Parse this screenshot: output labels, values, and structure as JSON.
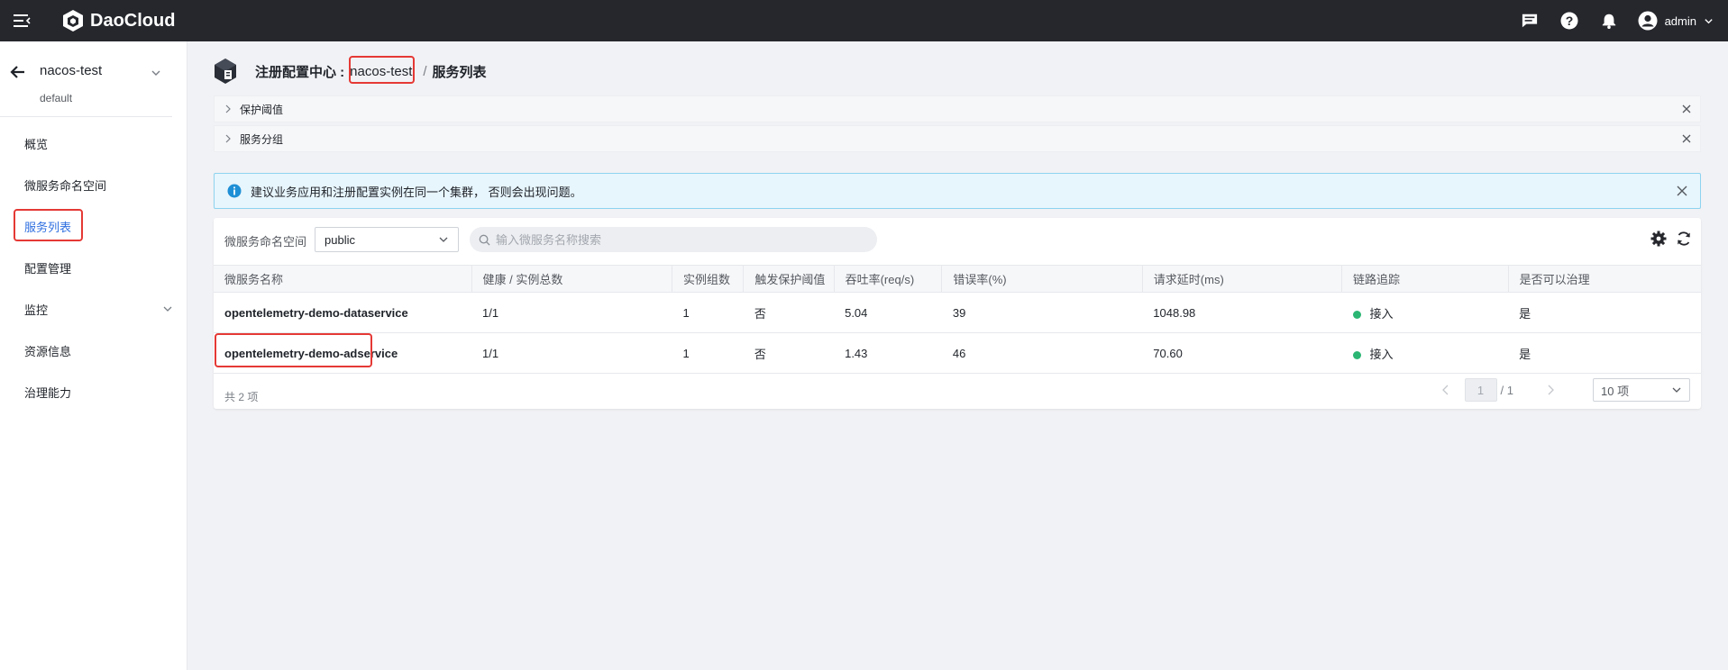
{
  "app": {
    "brand": "DaoCloud",
    "user": "admin"
  },
  "sidebar": {
    "title": "nacos-test",
    "subtitle": "default",
    "items": [
      {
        "label": "概览"
      },
      {
        "label": "微服务命名空间"
      },
      {
        "label": "服务列表"
      },
      {
        "label": "配置管理"
      },
      {
        "label": "监控"
      },
      {
        "label": "资源信息"
      },
      {
        "label": "治理能力"
      }
    ]
  },
  "breadcrumb": {
    "root": "注册配置中心 :",
    "instance": "nacos-test",
    "separator": "/",
    "current": "服务列表"
  },
  "panels": [
    {
      "label": "保护阈值"
    },
    {
      "label": "服务分组"
    }
  ],
  "alert": {
    "text": "建议业务应用和注册配置实例在同一个集群， 否则会出现问题。"
  },
  "filter": {
    "namespace_label": "微服务命名空间",
    "namespace_value": "public",
    "search_placeholder": "输入微服务名称搜索"
  },
  "table": {
    "columns": [
      "微服务名称",
      "健康 / 实例总数",
      "实例组数",
      "触发保护阈值",
      "吞吐率(req/s)",
      "错误率(%)",
      "请求延时(ms)",
      "链路追踪",
      "是否可以治理"
    ],
    "rows": [
      {
        "name": "opentelemetry-demo-dataservice",
        "health": "1/1",
        "groups": "1",
        "protect": "否",
        "throughput": "5.04",
        "error_rate": "39",
        "latency": "1048.98",
        "tracing": "接入",
        "governable": "是"
      },
      {
        "name": "opentelemetry-demo-adservice",
        "health": "1/1",
        "groups": "1",
        "protect": "否",
        "throughput": "1.43",
        "error_rate": "46",
        "latency": "70.60",
        "tracing": "接入",
        "governable": "是"
      }
    ]
  },
  "pagination": {
    "total": "共 2 项",
    "page": "1",
    "pages": "/ 1",
    "page_size": "10 项"
  },
  "colors": {
    "topbar": "#25272d",
    "accent": "#2f6fe0",
    "highlight": "#e53935",
    "status_ok": "#2bb673"
  }
}
